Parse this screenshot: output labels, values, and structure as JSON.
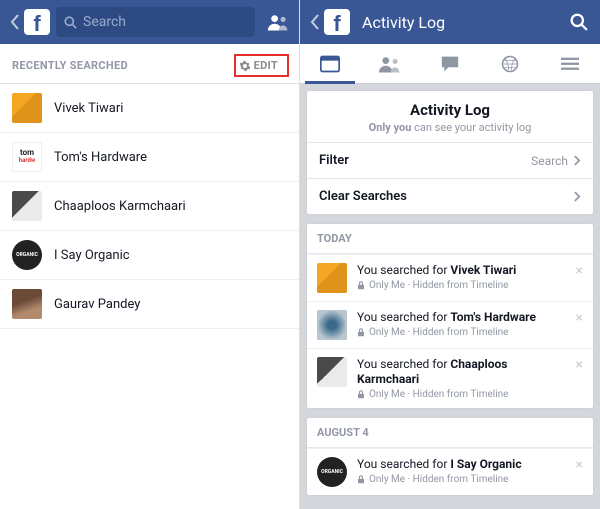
{
  "left": {
    "search_placeholder": "Search",
    "section_label": "RECENTLY SEARCHED",
    "edit_label": "EDIT",
    "items": [
      {
        "name": "Vivek Tiwari",
        "avatar": "orange"
      },
      {
        "name": "Tom's Hardware",
        "avatar": "toms"
      },
      {
        "name": "Chaaploos Karmchaari",
        "avatar": "bw"
      },
      {
        "name": "I Say Organic",
        "avatar": "organic"
      },
      {
        "name": "Gaurav Pandey",
        "avatar": "person"
      }
    ]
  },
  "right": {
    "header_title": "Activity Log",
    "card_title": "Activity Log",
    "card_sub_prefix": "Only you",
    "card_sub_rest": " can see your activity log",
    "filter_label": "Filter",
    "filter_value": "Search",
    "clear_label": "Clear Searches",
    "sections": [
      {
        "label": "TODAY",
        "items": [
          {
            "prefix": "You searched for ",
            "subject": "Vivek Tiwari",
            "avatar": "orange",
            "privacy": "Only Me",
            "hidden": "Hidden from Timeline"
          },
          {
            "prefix": "You searched for ",
            "subject": "Tom's Hardware",
            "avatar": "eye",
            "privacy": "Only Me",
            "hidden": "Hidden from Timeline"
          },
          {
            "prefix": "You searched for ",
            "subject": "Chaaploos Karmchaari",
            "avatar": "bw",
            "privacy": "Only Me",
            "hidden": "Hidden from Timeline"
          }
        ]
      },
      {
        "label": "AUGUST 4",
        "items": [
          {
            "prefix": "You searched for ",
            "subject": "I Say Organic",
            "avatar": "organic",
            "privacy": "Only Me",
            "hidden": "Hidden from Timeline"
          }
        ]
      }
    ]
  }
}
